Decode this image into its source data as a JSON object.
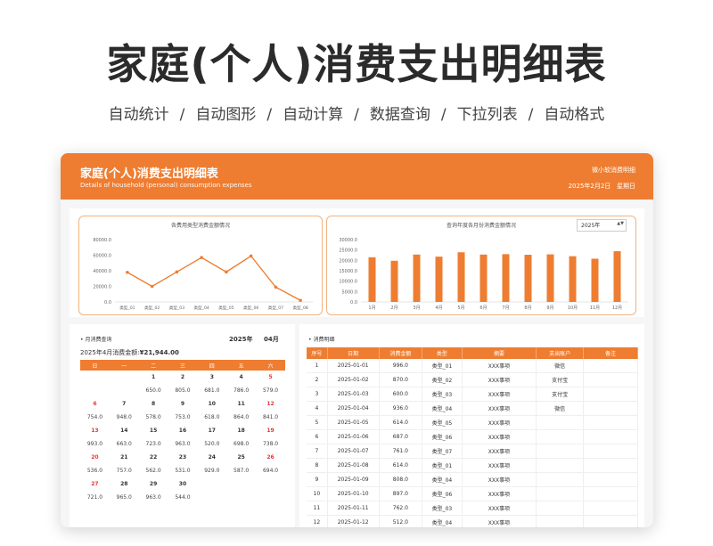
{
  "page": {
    "title": "家庭(个人)消费支出明细表",
    "features": [
      "自动统计",
      "自动图形",
      "自动计算",
      "数据查询",
      "下拉列表",
      "自动格式"
    ],
    "separator": "/"
  },
  "window": {
    "title": "家庭(个人)消费支出明细表",
    "subtitle": "Details of household (personal) consumption expenses",
    "brand": "微小软消费明细",
    "date": "2025年2月2日",
    "weekday": "星期日"
  },
  "chart_data": [
    {
      "type": "line",
      "title": "各费用类型消费金额情况",
      "categories": [
        "类型_01",
        "类型_02",
        "类型_03",
        "类型_04",
        "类型_05",
        "类型_06",
        "类型_07",
        "类型_08"
      ],
      "values": [
        38000,
        20000,
        38500,
        57000,
        38500,
        59000,
        19000,
        2000
      ],
      "ylim": [
        0,
        80000
      ],
      "yticks": [
        "80000.0",
        "60000.0",
        "40000.0",
        "20000.0",
        "0.0"
      ],
      "color": "#ee7d31",
      "grid": false
    },
    {
      "type": "bar",
      "title": "查询年度各月份消费金额情况",
      "categories": [
        "1月",
        "2月",
        "3月",
        "4月",
        "5月",
        "6月",
        "7月",
        "8月",
        "9月",
        "10月",
        "11月",
        "12月"
      ],
      "values": [
        21500,
        19800,
        22800,
        21800,
        23900,
        22800,
        23000,
        22700,
        22900,
        22000,
        20800,
        24400
      ],
      "ylim": [
        0,
        30000
      ],
      "yticks": [
        "30000.0",
        "25000.0",
        "20000.0",
        "15000.0",
        "10000.0",
        "5000.0",
        "0.0"
      ],
      "color": "#ee7d31",
      "grid": false
    }
  ],
  "year_select": {
    "value": "2025年",
    "arrows": "▲▼"
  },
  "calendar": {
    "section_label": "• 月消费查询",
    "year": "2025年",
    "month": "04月",
    "total_label": "2025年4月消费金额:",
    "total_value": "¥21,944.00",
    "weekdays": [
      "日",
      "一",
      "二",
      "三",
      "四",
      "五",
      "六"
    ],
    "weeks": [
      {
        "days": [
          "",
          "",
          "1",
          "2",
          "3",
          "4",
          "5"
        ],
        "amounts": [
          "",
          "",
          "650.0",
          "805.0",
          "681.0",
          "786.0",
          "579.0"
        ]
      },
      {
        "days": [
          "6",
          "7",
          "8",
          "9",
          "10",
          "11",
          "12"
        ],
        "amounts": [
          "754.0",
          "948.0",
          "578.0",
          "753.0",
          "618.0",
          "864.0",
          "841.0"
        ]
      },
      {
        "days": [
          "13",
          "14",
          "15",
          "16",
          "17",
          "18",
          "19"
        ],
        "amounts": [
          "993.0",
          "663.0",
          "723.0",
          "963.0",
          "520.0",
          "698.0",
          "738.0"
        ]
      },
      {
        "days": [
          "20",
          "21",
          "22",
          "23",
          "24",
          "25",
          "26"
        ],
        "amounts": [
          "536.0",
          "757.0",
          "562.0",
          "531.0",
          "929.0",
          "587.0",
          "694.0"
        ]
      },
      {
        "days": [
          "27",
          "28",
          "29",
          "30",
          "",
          "",
          ""
        ],
        "amounts": [
          "721.0",
          "965.0",
          "963.0",
          "544.0",
          "",
          "",
          ""
        ]
      }
    ]
  },
  "details": {
    "section_label": "• 消费明细",
    "headers": [
      "序号",
      "日期",
      "消费金额",
      "类型",
      "摘要",
      "支出账户",
      "备注"
    ],
    "rows": [
      [
        "1",
        "2025-01-01",
        "996.0",
        "类型_01",
        "XXX事项",
        "微信",
        ""
      ],
      [
        "2",
        "2025-01-02",
        "870.0",
        "类型_02",
        "XXX事项",
        "支付宝",
        ""
      ],
      [
        "3",
        "2025-01-03",
        "600.0",
        "类型_03",
        "XXX事项",
        "支付宝",
        ""
      ],
      [
        "4",
        "2025-01-04",
        "936.0",
        "类型_04",
        "XXX事项",
        "微信",
        ""
      ],
      [
        "5",
        "2025-01-05",
        "614.0",
        "类型_05",
        "XXX事项",
        "",
        ""
      ],
      [
        "6",
        "2025-01-06",
        "687.0",
        "类型_06",
        "XXX事项",
        "",
        ""
      ],
      [
        "7",
        "2025-01-07",
        "761.0",
        "类型_07",
        "XXX事项",
        "",
        ""
      ],
      [
        "8",
        "2025-01-08",
        "614.0",
        "类型_01",
        "XXX事项",
        "",
        ""
      ],
      [
        "9",
        "2025-01-09",
        "808.0",
        "类型_04",
        "XXX事项",
        "",
        ""
      ],
      [
        "10",
        "2025-01-10",
        "897.0",
        "类型_06",
        "XXX事项",
        "",
        ""
      ],
      [
        "11",
        "2025-01-11",
        "762.0",
        "类型_03",
        "XXX事项",
        "",
        ""
      ],
      [
        "12",
        "2025-01-12",
        "512.0",
        "类型_04",
        "XXX事项",
        "",
        ""
      ]
    ]
  }
}
